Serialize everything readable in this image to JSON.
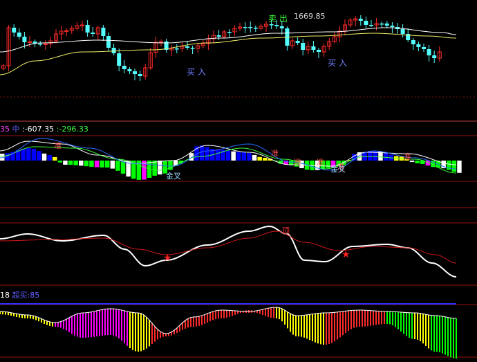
{
  "colors": {
    "up": "#ff2a2a",
    "down": "#54ffff",
    "ma_white": "#ffffff",
    "ma_yellow": "#f2f06a",
    "grid_red": "#9a1010",
    "divider": "#c04040",
    "blue_bar": "#0000ff",
    "yellow_bar": "#ffff00",
    "green_bar": "#00ff00",
    "magenta": "#ff00ff",
    "white_bar": "#ffffff"
  },
  "price_panel": {
    "sell_label": "卖 出",
    "high_value": "1669.85",
    "buy_label_1": "买 入",
    "buy_label_2": "买 入"
  },
  "panel2": {
    "prefix": "35",
    "name": "中",
    "value1": ":-607.35",
    "value2": ":-296.33",
    "markers": [
      "准",
      "准",
      "准",
      "准",
      "准",
      "准"
    ],
    "lower_markers": [
      "金叉",
      "金叉"
    ]
  },
  "panel3": {
    "top_label": "顶",
    "star_symbol": "★"
  },
  "panel4": {
    "prefix": "18",
    "label": "超买:85"
  },
  "chart_data": [
    {
      "type": "candlestick",
      "title": "",
      "series": [
        {
          "name": "k-line",
          "values": []
        }
      ]
    }
  ]
}
